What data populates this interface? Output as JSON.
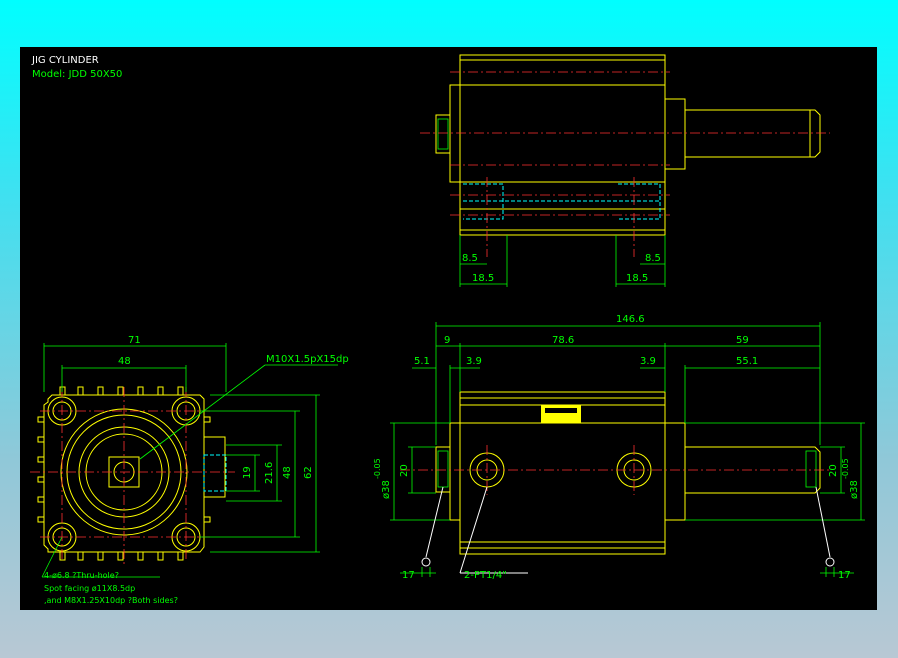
{
  "title": "JIG CYLINDER",
  "model": "Model:  JDD 50X50",
  "dims": {
    "d71": "71",
    "d48": "48",
    "d19": "19",
    "d216": "21.6",
    "d48v": "48",
    "d62": "62",
    "thread_note": "M10X1.5pX15dp",
    "hole_note1": "4-ø6.8 ?Thru-hole?",
    "hole_note2": "Spot facing  ø11X8.5dp",
    "hole_note3": ",and M8X1.25X10dp ?Both sides?",
    "top_85_left": "8.5",
    "top_185_left": "18.5",
    "top_85_right": "8.5",
    "top_185_right": "18.5",
    "overall": "146.6",
    "d9": "9",
    "d786": "78.6",
    "d59": "59",
    "d51": "5.1",
    "d39a": "3.9",
    "d39b": "3.9",
    "d551": "55.1",
    "d20_left": "20",
    "d20_right": "20",
    "phi38_left": "ø38",
    "phi38_right": "ø38",
    "tol_left": "-0.05",
    "tol_right": "-0.05",
    "d17_left": "17",
    "d17_right": "17",
    "port_note": "2-PT1/4\""
  }
}
